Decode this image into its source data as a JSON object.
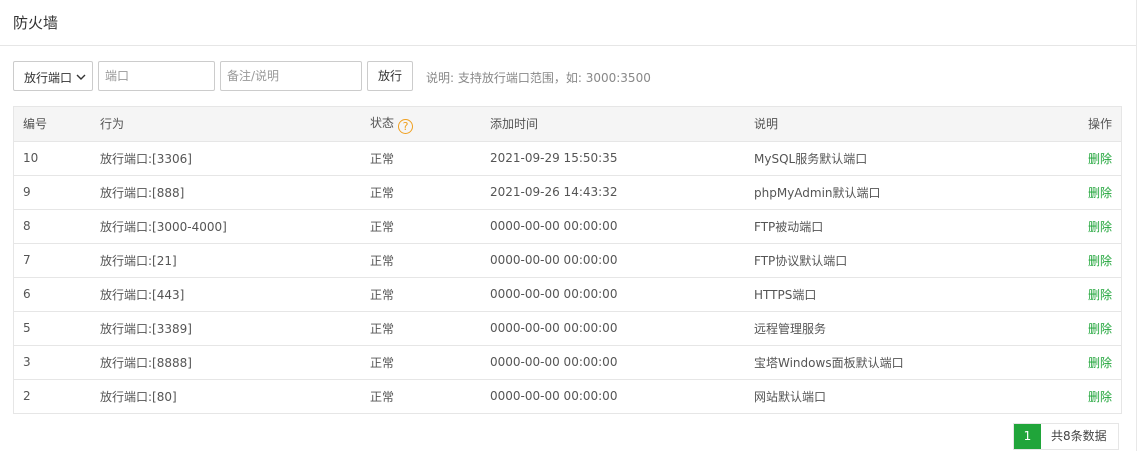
{
  "header": {
    "title": "防火墙"
  },
  "toolbar": {
    "select_value": "放行端口",
    "port_placeholder": "端口",
    "note_placeholder": "备注/说明",
    "allow_button": "放行",
    "hint": "说明: 支持放行端口范围，如: 3000:3500"
  },
  "table": {
    "columns": {
      "id": "编号",
      "action": "行为",
      "status": "状态",
      "time": "添加时间",
      "desc": "说明",
      "op": "操作"
    },
    "help_glyph": "?",
    "rows": [
      {
        "id": "10",
        "action": "放行端口:[3306]",
        "status": "正常",
        "time": "2021-09-29 15:50:35",
        "desc": "MySQL服务默认端口",
        "op": "删除"
      },
      {
        "id": "9",
        "action": "放行端口:[888]",
        "status": "正常",
        "time": "2021-09-26 14:43:32",
        "desc": "phpMyAdmin默认端口",
        "op": "删除"
      },
      {
        "id": "8",
        "action": "放行端口:[3000-4000]",
        "status": "正常",
        "time": "0000-00-00 00:00:00",
        "desc": "FTP被动端口",
        "op": "删除"
      },
      {
        "id": "7",
        "action": "放行端口:[21]",
        "status": "正常",
        "time": "0000-00-00 00:00:00",
        "desc": "FTP协议默认端口",
        "op": "删除"
      },
      {
        "id": "6",
        "action": "放行端口:[443]",
        "status": "正常",
        "time": "0000-00-00 00:00:00",
        "desc": "HTTPS端口",
        "op": "删除"
      },
      {
        "id": "5",
        "action": "放行端口:[3389]",
        "status": "正常",
        "time": "0000-00-00 00:00:00",
        "desc": "远程管理服务",
        "op": "删除"
      },
      {
        "id": "3",
        "action": "放行端口:[8888]",
        "status": "正常",
        "time": "0000-00-00 00:00:00",
        "desc": "宝塔Windows面板默认端口",
        "op": "删除"
      },
      {
        "id": "2",
        "action": "放行端口:[80]",
        "status": "正常",
        "time": "0000-00-00 00:00:00",
        "desc": "网站默认端口",
        "op": "删除"
      }
    ]
  },
  "pagination": {
    "current": "1",
    "total_text": "共8条数据"
  },
  "colors": {
    "accent": "#20a53a",
    "help": "#f0a020"
  },
  "icons": {
    "select_arrow": "chevron-down-icon",
    "help": "help-circle-icon"
  }
}
